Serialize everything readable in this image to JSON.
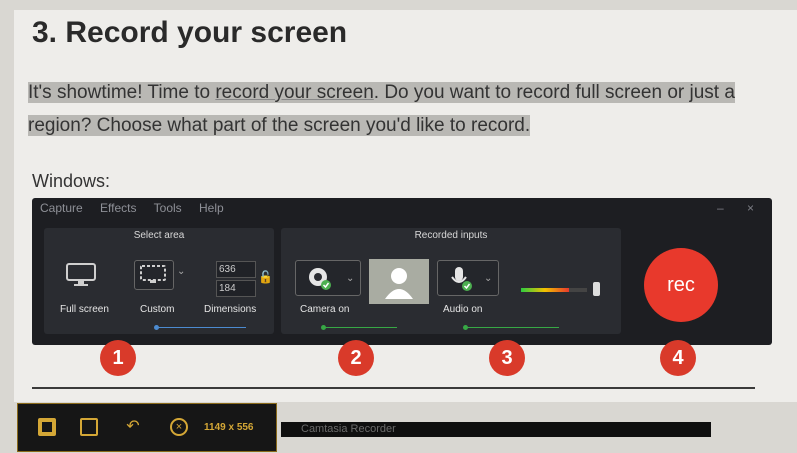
{
  "article": {
    "heading": "3. Record your screen",
    "para_pre": "It's showtime! Time to ",
    "para_link": "record your screen",
    "para_post": ". Do you want to record full screen or just a region? Choose what part of the screen you'd like to record.",
    "windows_label": "Windows:"
  },
  "recorder": {
    "menu": [
      "Capture",
      "Effects",
      "Tools",
      "Help"
    ],
    "window_controls": "– ×",
    "select_area": {
      "title": "Select area",
      "full_screen": "Full screen",
      "custom": "Custom",
      "dimensions": "Dimensions",
      "width": "636",
      "height": "184"
    },
    "recorded_inputs": {
      "title": "Recorded inputs",
      "camera": "Camera on",
      "audio": "Audio on",
      "audio_level": 0.72
    },
    "rec_label": "rec"
  },
  "badges": [
    "1",
    "2",
    "3",
    "4"
  ],
  "taskbar": {
    "size": "1149 x 556",
    "strip_label": "Camtasia Recorder"
  },
  "colors": {
    "accent_red": "#e8392c",
    "badge_red": "#d93a2a",
    "panel_bg": "#2a2c31",
    "window_bg": "#1d1e22",
    "taskbar_border": "#8a6a1a"
  }
}
